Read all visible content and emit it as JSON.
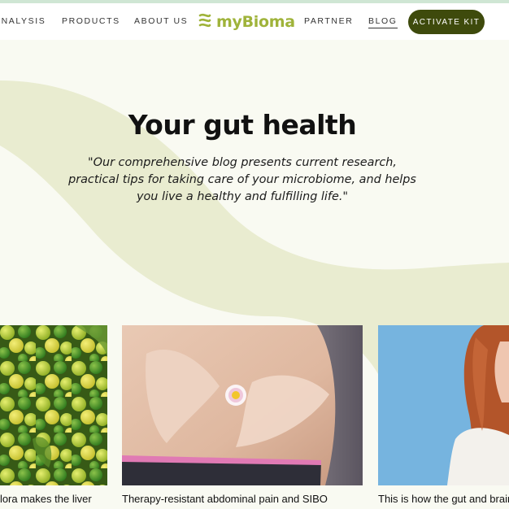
{
  "nav": {
    "items": [
      {
        "label": "ANALYSIS"
      },
      {
        "label": "PRODUCTS"
      },
      {
        "label": "ABOUT US"
      },
      {
        "label": "PARTNER"
      },
      {
        "label": "BLOG"
      }
    ],
    "logo_text": "myBioma",
    "cta_label": "ACTIVATE KIT"
  },
  "hero": {
    "title": "Your gut health",
    "subtitle": "\"Our comprehensive blog presents current research, practical tips for taking care of your microbiome, and helps you live a healthy and fulfilling life.\""
  },
  "articles": [
    {
      "title": "Flora makes the liver",
      "image": "limes-and-lemons"
    },
    {
      "title": "Therapy-resistant abdominal pain and SIBO",
      "image": "hands-heart-on-belly-with-daisy"
    },
    {
      "title": "This is how the gut and brain",
      "image": "woman-with-red-hair"
    }
  ],
  "colors": {
    "brand_green": "#9fb33a",
    "cta_bg": "#3e4a0c",
    "background": "#f9faf2",
    "wave": "#e9ecd0"
  }
}
